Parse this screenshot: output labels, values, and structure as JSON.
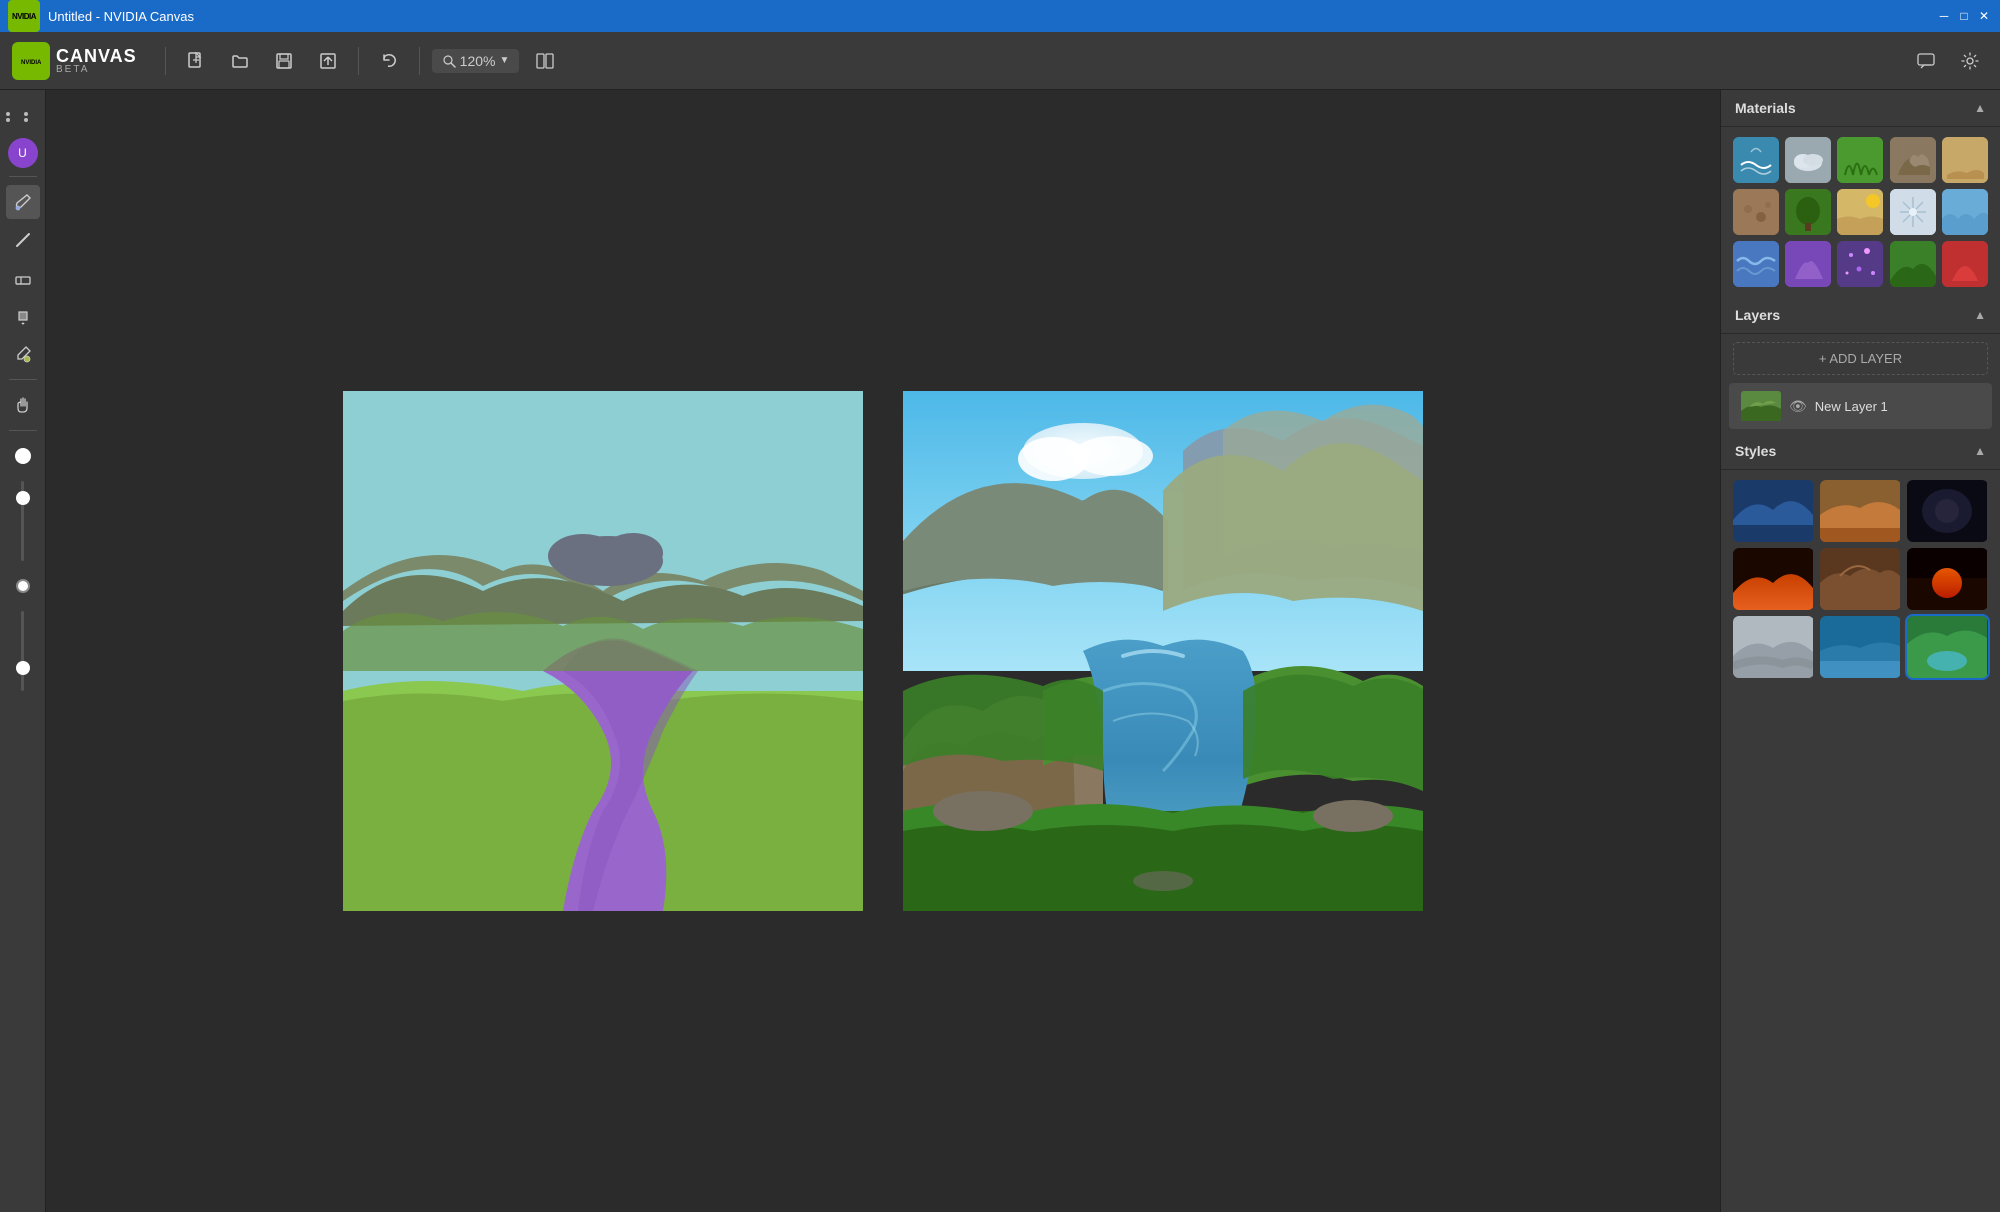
{
  "titlebar": {
    "title": "Untitled - NVIDIA Canvas",
    "controls": [
      "minimize",
      "maximize",
      "close"
    ]
  },
  "app": {
    "brand": "CANVAS",
    "brand_badge": "BETA",
    "logo_text": "NVIDIA"
  },
  "toolbar": {
    "new_label": "New",
    "open_label": "Open",
    "save_label": "Save",
    "export_label": "Export",
    "undo_label": "Undo",
    "zoom_value": "120%",
    "compare_label": "Compare"
  },
  "left_tools": {
    "grid_label": "Grid",
    "brush_label": "Brush",
    "line_label": "Line",
    "eraser_label": "Eraser",
    "fill_label": "Fill",
    "picker_label": "Color Picker",
    "hand_label": "Hand/Pan"
  },
  "materials": {
    "title": "Materials",
    "items": [
      {
        "name": "Water",
        "class": "mat-water",
        "icon": "🌊"
      },
      {
        "name": "Cloud",
        "class": "mat-cloud",
        "icon": "☁️"
      },
      {
        "name": "Grass",
        "class": "mat-grass",
        "icon": "🌿"
      },
      {
        "name": "Rock",
        "class": "mat-rock",
        "icon": "🪨"
      },
      {
        "name": "Sand",
        "class": "mat-sand",
        "icon": "🏜️"
      },
      {
        "name": "Dirt",
        "class": "mat-dirt",
        "icon": "🟫"
      },
      {
        "name": "Tree",
        "class": "mat-tree",
        "icon": "🌳"
      },
      {
        "name": "Beach",
        "class": "mat-beach",
        "icon": "🏖️"
      },
      {
        "name": "Snow",
        "class": "mat-snow",
        "icon": "❄️"
      },
      {
        "name": "Sky",
        "class": "mat-sky",
        "icon": "🌤️"
      },
      {
        "name": "Waves",
        "class": "mat-waves",
        "icon": "🌊"
      },
      {
        "name": "Purple",
        "class": "mat-purple",
        "icon": "💜"
      },
      {
        "name": "Sparkle",
        "class": "mat-sparkle",
        "icon": "✨"
      },
      {
        "name": "GreenHill",
        "class": "mat-greenhill",
        "icon": "⛰️"
      },
      {
        "name": "Red",
        "class": "mat-red",
        "icon": "🔴"
      }
    ]
  },
  "layers": {
    "title": "Layers",
    "add_label": "+ ADD LAYER",
    "items": [
      {
        "name": "New Layer 1",
        "visible": true
      }
    ]
  },
  "styles": {
    "title": "Styles",
    "items": [
      {
        "name": "Blue Mountains",
        "class": "style-blue"
      },
      {
        "name": "Desert",
        "class": "style-desert"
      },
      {
        "name": "Dark",
        "class": "style-dark"
      },
      {
        "name": "Orange Sunset",
        "class": "style-orange"
      },
      {
        "name": "Brown Rock",
        "class": "style-brown"
      },
      {
        "name": "Sunset",
        "class": "style-sunset"
      },
      {
        "name": "Misty",
        "class": "style-misty"
      },
      {
        "name": "Coastal",
        "class": "style-coastal"
      },
      {
        "name": "Lakeview",
        "class": "style-lakeview",
        "selected": true
      }
    ]
  },
  "colors": {
    "titlebar_bg": "#1a6bc8",
    "toolbar_bg": "#3a3a3a",
    "sidebar_bg": "#3a3a3a",
    "panel_bg": "#3a3a3a",
    "canvas_bg": "#2b2b2b",
    "accent_green": "#76b900",
    "selected_blue": "#1a6bc8"
  }
}
